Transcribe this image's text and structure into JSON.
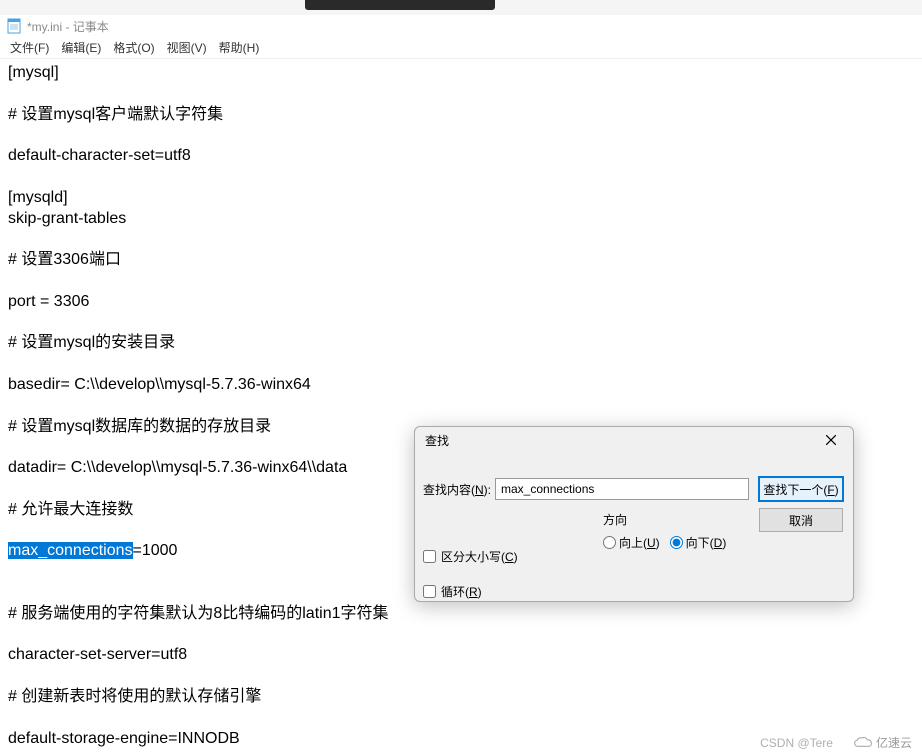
{
  "window": {
    "title": "*my.ini - 记事本"
  },
  "menu": {
    "file": "文件(F)",
    "edit": "编辑(E)",
    "format": "格式(O)",
    "view": "视图(V)",
    "help": "帮助(H)"
  },
  "editor": {
    "lines": [
      "[mysql]",
      "",
      "# 设置mysql客户端默认字符集",
      "",
      "default-character-set=utf8",
      "",
      "[mysqld]",
      "skip-grant-tables",
      "",
      "# 设置3306端口",
      "",
      "port = 3306",
      "",
      "# 设置mysql的安装目录",
      "",
      "basedir= C:\\\\develop\\\\mysql-5.7.36-winx64",
      "",
      "# 设置mysql数据库的数据的存放目录",
      "",
      "datadir= C:\\\\develop\\\\mysql-5.7.36-winx64\\\\data",
      "",
      "# 允许最大连接数",
      "",
      "",
      "",
      "# 服务端使用的字符集默认为8比特编码的latin1字符集",
      "",
      "character-set-server=utf8",
      "",
      "# 创建新表时将使用的默认存储引擎",
      "",
      "default-storage-engine=INNODB"
    ],
    "highlighted_line": {
      "highlighted": "max_connections",
      "remainder": "=1000"
    }
  },
  "find_dialog": {
    "title": "查找",
    "label": "查找内容(",
    "label_u": "N",
    "label_after": "):",
    "input_value": "max_connections",
    "find_next": "查找下一个(",
    "find_next_u": "F",
    "find_next_after": ")",
    "cancel": "取消",
    "match_case": "区分大小写(",
    "match_case_u": "C",
    "match_case_after": ")",
    "wrap": "循环(",
    "wrap_u": "R",
    "wrap_after": ")",
    "direction_label": "方向",
    "up": "向上(",
    "up_u": "U",
    "up_after": ")",
    "down": "向下(",
    "down_u": "D",
    "down_after": ")"
  },
  "watermark": {
    "csdn": "CSDN @Tere",
    "yisu": "亿速云"
  }
}
